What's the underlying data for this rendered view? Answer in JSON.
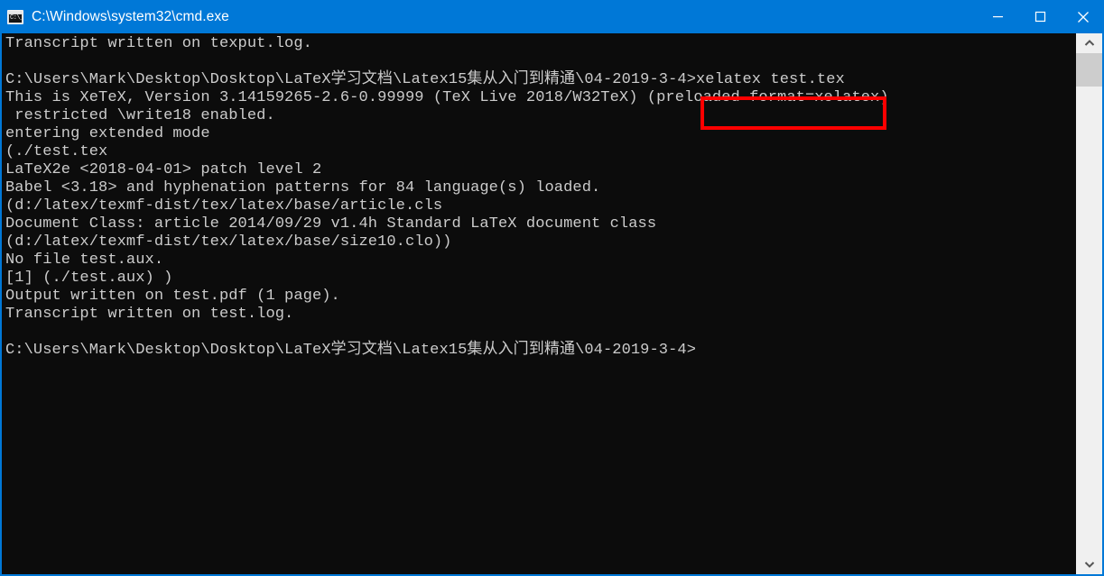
{
  "window": {
    "title": "C:\\Windows\\system32\\cmd.exe",
    "icon": "cmd-console-icon",
    "icon_glyph": "C:\\_",
    "titlebar_color": "#0078d7",
    "background_color": "#0c0c0c",
    "text_color": "#cccccc",
    "border_color": "#0078d7"
  },
  "window_controls": {
    "minimize": "minimize-icon",
    "maximize": "maximize-icon",
    "close": "close-icon"
  },
  "console": {
    "lines": [
      "Transcript written on texput.log.",
      "",
      "C:\\Users\\Mark\\Desktop\\Dosktop\\LaTeX学习文档\\Latex15集从入门到精通\\04-2019-3-4>xelatex test.tex",
      "This is XeTeX, Version 3.14159265-2.6-0.99999 (TeX Live 2018/W32TeX) (preloaded format=xelatex)",
      " restricted \\write18 enabled.",
      "entering extended mode",
      "(./test.tex",
      "LaTeX2e <2018-04-01> patch level 2",
      "Babel <3.18> and hyphenation patterns for 84 language(s) loaded.",
      "(d:/latex/texmf-dist/tex/latex/base/article.cls",
      "Document Class: article 2014/09/29 v1.4h Standard LaTeX document class",
      "(d:/latex/texmf-dist/tex/latex/base/size10.clo))",
      "No file test.aux.",
      "[1] (./test.aux) )",
      "Output written on test.pdf (1 page).",
      "Transcript written on test.log.",
      "",
      "C:\\Users\\Mark\\Desktop\\Dosktop\\LaTeX学习文档\\Latex15集从入门到精通\\04-2019-3-4>"
    ],
    "prompt_path": "C:\\Users\\Mark\\Desktop\\Dosktop\\LaTeX学习文档\\Latex15集从入门到精通\\04-2019-3-4>",
    "highlighted_command": "xelatex test.tex"
  },
  "annotation": {
    "type": "rectangle",
    "color": "#ff0000",
    "target_text": "xelatex test.tex"
  },
  "scrollbar": {
    "up_arrow": "chevron-up-icon",
    "down_arrow": "chevron-down-icon",
    "track_color": "#f0f0f0",
    "thumb_color": "#cdcdcd"
  }
}
